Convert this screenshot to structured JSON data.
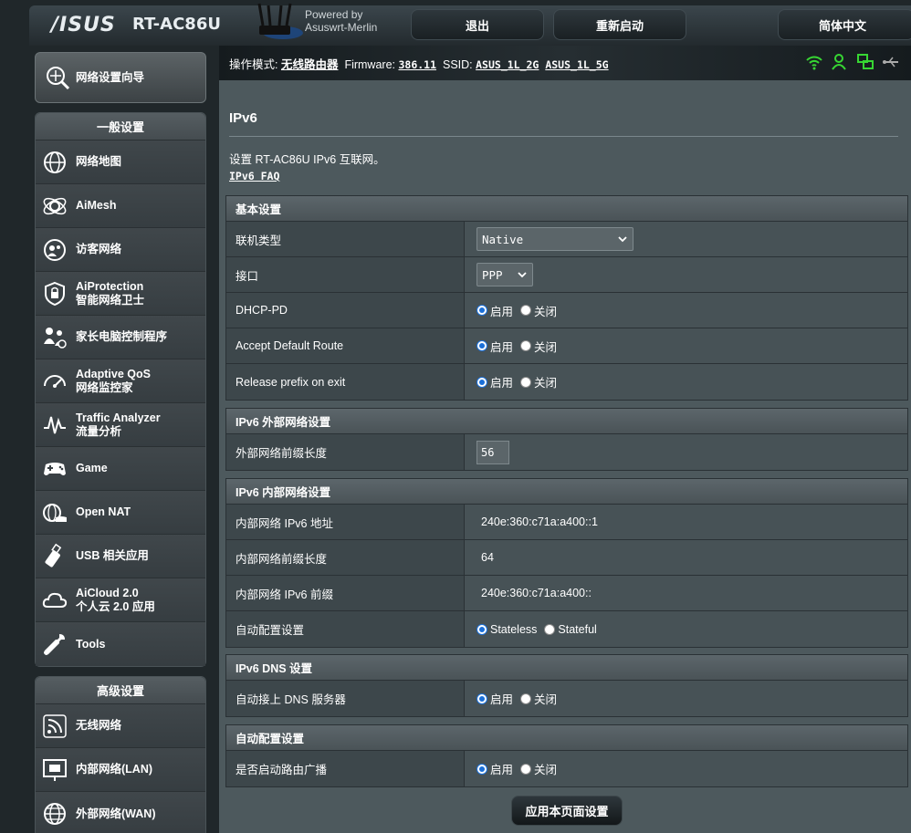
{
  "header": {
    "logo": "/ISUS",
    "model": "RT-AC86U",
    "powered_by_line1": "Powered by",
    "powered_by_line2": "Asuswrt-Merlin",
    "logout_label": "退出",
    "reboot_label": "重新启动",
    "language_label": "简体中文"
  },
  "statusbar": {
    "mode_label": "操作模式:",
    "mode_value": "无线路由器",
    "firmware_label": "Firmware:",
    "firmware_value": "386.11",
    "ssid_label": "SSID:",
    "ssid_2g": "ASUS_1L_2G",
    "ssid_5g": "ASUS_1L_5G",
    "icons": [
      "wifi-icon",
      "user-icon",
      "network-icon",
      "usb-icon"
    ],
    "icon_color": "#37d633"
  },
  "sidebar": {
    "wizard_label": "网络设置向导",
    "general_title": "一般设置",
    "general_items": [
      {
        "l1": "网络地图",
        "l2": ""
      },
      {
        "l1": "AiMesh",
        "l2": ""
      },
      {
        "l1": "访客网络",
        "l2": ""
      },
      {
        "l1": "AiProtection",
        "l2": "智能网络卫士"
      },
      {
        "l1": "家长电脑控制程序",
        "l2": ""
      },
      {
        "l1": "Adaptive QoS",
        "l2": "网络监控家"
      },
      {
        "l1": "Traffic Analyzer",
        "l2": "流量分析"
      },
      {
        "l1": "Game",
        "l2": ""
      },
      {
        "l1": "Open NAT",
        "l2": ""
      },
      {
        "l1": "USB 相关应用",
        "l2": ""
      },
      {
        "l1": "AiCloud 2.0",
        "l2": "个人云 2.0 应用"
      },
      {
        "l1": "Tools",
        "l2": ""
      }
    ],
    "advanced_title": "高级设置",
    "advanced_items": [
      {
        "l1": "无线网络"
      },
      {
        "l1": "内部网络(LAN)"
      },
      {
        "l1": "外部网络(WAN)"
      }
    ]
  },
  "main": {
    "title": "IPv6",
    "description": "设置 RT-AC86U IPv6 互联网。",
    "faq_link": "IPv6 FAQ",
    "basic": {
      "heading": "基本设置",
      "connection_type_label": "联机类型",
      "connection_type_value": "Native",
      "interface_label": "接口",
      "interface_value": "PPP",
      "dhcp_pd_label": "DHCP-PD",
      "accept_route_label": "Accept Default Route",
      "release_prefix_label": "Release prefix on exit",
      "enable": "启用",
      "disable": "关闭"
    },
    "wan": {
      "heading": "IPv6 外部网络设置",
      "prefix_len_label": "外部网络前缀长度",
      "prefix_len_value": "56"
    },
    "lan": {
      "heading": "IPv6 内部网络设置",
      "addr_label": "内部网络 IPv6 地址",
      "addr_value": "240e:360:c71a:a400::1",
      "prefix_len_label": "内部网络前缀长度",
      "prefix_len_value": "64",
      "prefix_label": "内部网络 IPv6 前缀",
      "prefix_value": "240e:360:c71a:a400::",
      "autoconf_label": "自动配置设置",
      "stateless": "Stateless",
      "stateful": "Stateful"
    },
    "dns": {
      "heading": "IPv6 DNS 设置",
      "auto_dns_label": "自动接上 DNS 服务器"
    },
    "autoconf": {
      "heading": "自动配置设置",
      "router_adv_label": "是否启动路由广播"
    },
    "apply_label": "应用本页面设置"
  }
}
